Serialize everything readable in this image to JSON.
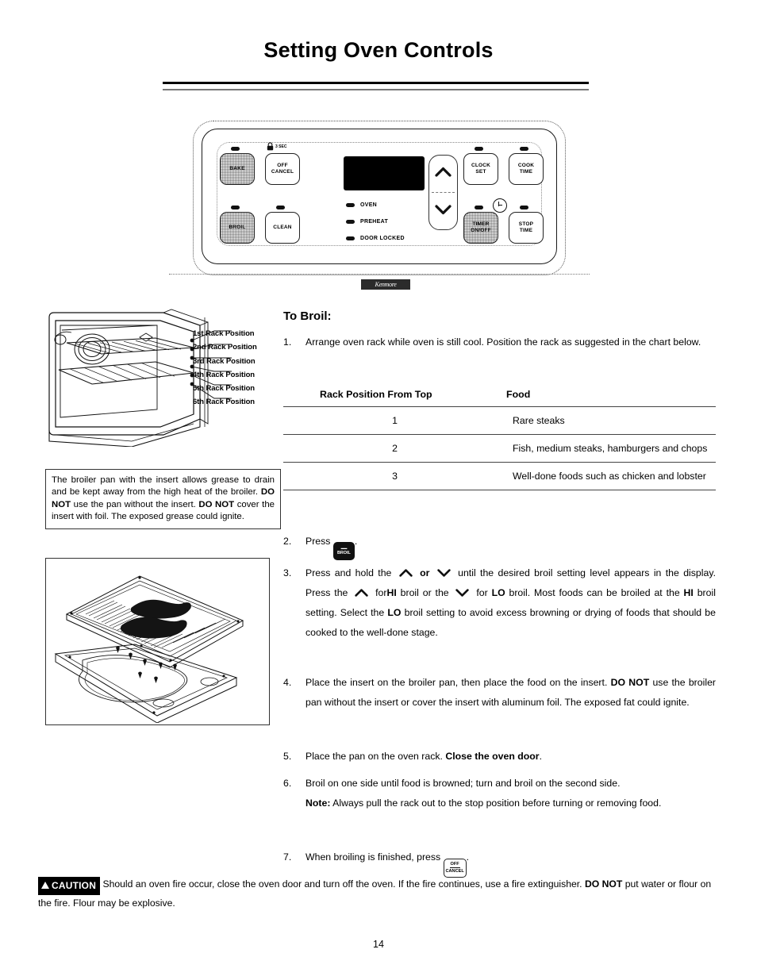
{
  "page": {
    "title": "Setting Oven Controls",
    "number": "14"
  },
  "control_panel": {
    "brand_badge": "Kenmore",
    "buttons": [
      {
        "name": "bake",
        "line1": "BAKE",
        "line2": ""
      },
      {
        "name": "off-cancel",
        "line1": "OFF",
        "line2": "CANCEL"
      },
      {
        "name": "broil",
        "line1": "BROIL",
        "line2": ""
      },
      {
        "name": "clean",
        "line1": "CLEAN",
        "line2": ""
      },
      {
        "name": "clock-set",
        "line1": "CLOCK",
        "line2": "SET"
      },
      {
        "name": "cook-time",
        "line1": "COOK",
        "line2": "TIME"
      },
      {
        "name": "timer-on-off",
        "line1": "TIMER",
        "line2": "ON/OFF"
      },
      {
        "name": "stop-time",
        "line1": "STOP",
        "line2": "TIME"
      }
    ],
    "lock_hint": "3 SEC",
    "indicators": [
      "OVEN",
      "PREHEAT",
      "DOOR LOCKED"
    ],
    "arrow_up": "up-arrow",
    "arrow_down": "down-arrow"
  },
  "oven_diagram": {
    "rack_labels": [
      "1st Rack Position",
      "2nd Rack Position",
      "3rd Rack Position",
      "4th Rack Position",
      "5th Rack Position",
      "6th Rack Position"
    ]
  },
  "note_box": {
    "part1": "The broiler pan with the insert allows grease to drain and be kept away from the high heat of the broiler. ",
    "bold1": "DO NOT",
    "part2": " use the pan without the insert. ",
    "bold2": "DO NOT",
    "part3": " cover the insert with foil. The exposed grease could ignite."
  },
  "section": {
    "heading": "To Broil:"
  },
  "steps": {
    "s1": {
      "num": "1.",
      "text": "Arrange oven rack while oven is still cool. Position the rack as suggested in the chart below."
    },
    "s2": {
      "num": "2.",
      "pre": "Press",
      "button_line1": "BROIL",
      "post": "."
    },
    "s3": {
      "num": "3.",
      "t1": "Press and hold the",
      "t2": "or",
      "t3": "until the desired broil setting level appears in the display. Press the",
      "t4": "for",
      "hi": "HI",
      "t5": "broil or the",
      "t6": "for",
      "lo": "LO",
      "t7": "broil. Most foods can be broiled at the",
      "hi2": "HI",
      "t8": "broil setting. Select the",
      "lo2": "LO",
      "t9": "broil setting to avoid excess browning or drying of foods that should be cooked to the well-done stage."
    },
    "s4": {
      "num": "4.",
      "t1": "Place the insert on the broiler pan, then place the food on the insert. ",
      "bold": "DO NOT",
      "t2": " use the broiler pan without the insert or cover the insert with aluminum foil. The exposed fat could ignite."
    },
    "s5": {
      "num": "5.",
      "t1": "Place the pan on the oven rack. ",
      "bold": "Close the oven door",
      "t2": "."
    },
    "s6": {
      "num": "6.",
      "t1": "Broil on one side until food is browned; turn and broil  on the second side.",
      "note_label": "Note:",
      "note_text": " Always pull the rack out to the stop position before turning or removing food."
    },
    "s7": {
      "num": "7.",
      "pre": "When broiling is finished, press",
      "button_line1": "OFF",
      "button_line2": "CANCEL",
      "post": "."
    }
  },
  "broil_table": {
    "headers": [
      "Rack Position From Top",
      "Food"
    ],
    "rows": [
      {
        "rack": "1",
        "food": "Rare steaks"
      },
      {
        "rack": "2",
        "food": "Fish, medium steaks, hamburgers and chops"
      },
      {
        "rack": "3",
        "food": "Well-done foods such as chicken and lobster"
      }
    ]
  },
  "caution": {
    "badge": "CAUTION",
    "t1": "Should an oven fire occur, close the oven door and turn off the oven. If the fire continues, use a fire extinguisher. ",
    "bold": "DO NOT",
    "t2": " put water or flour on the fire. Flour may be explosive."
  }
}
